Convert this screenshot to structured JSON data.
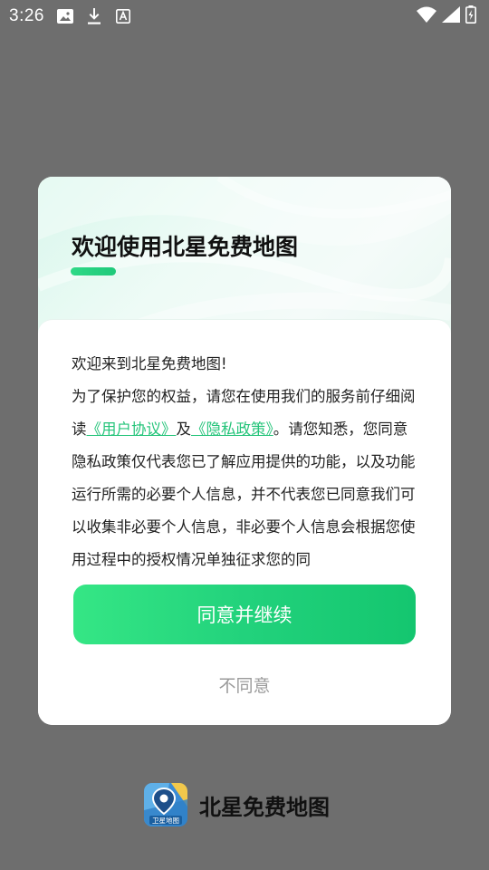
{
  "status_bar": {
    "time": "3:26",
    "left_icons": [
      "image-icon",
      "download-icon",
      "a-box-icon"
    ],
    "right_icons": [
      "wifi-icon",
      "signal-icon",
      "battery-icon"
    ]
  },
  "dialog": {
    "title": "欢迎使用北星免费地图",
    "greeting": "欢迎来到北星免费地图!",
    "text_part1": "为了保护您的权益，请您在使用我们的服务前仔细阅读",
    "user_agreement_link": "《用户协议》",
    "and": "及",
    "privacy_policy_link": "《隐私政策》",
    "text_part2": "。请您知悉，您同意隐私政策仅代表您已了解应用提供的功能，以及功能运行所需的必要个人信息，并不代表您已同意我们可以收集非必要个人信息，非必要个人信息会根据您使用过程中的授权情况单独征求您的同",
    "agree_label": "同意并继续",
    "disagree_label": "不同意"
  },
  "brand": {
    "logo_text": "卫星地图",
    "name": "北星免费地图"
  },
  "colors": {
    "accent": "#22d27c",
    "link": "#25c47a",
    "overlay": "#6e6e6e"
  }
}
